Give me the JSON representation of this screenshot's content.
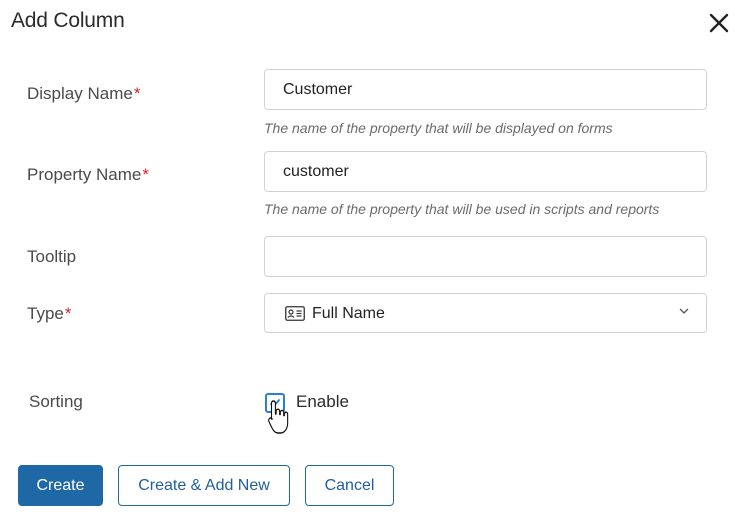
{
  "dialog": {
    "title": "Add Column"
  },
  "form": {
    "display_name": {
      "label": "Display Name",
      "required_mark": "*",
      "value": "Customer",
      "hint": "The name of the property that will be displayed on forms"
    },
    "property_name": {
      "label": "Property Name",
      "required_mark": "*",
      "value": "customer",
      "hint": "The name of the property that will be used in scripts and reports"
    },
    "tooltip": {
      "label": "Tooltip",
      "value": ""
    },
    "type": {
      "label": "Type",
      "required_mark": "*",
      "selected": "Full Name",
      "icon": "id-card-icon"
    },
    "sorting": {
      "label": "Sorting",
      "checkbox_label": "Enable",
      "checked": true
    }
  },
  "buttons": {
    "create": "Create",
    "create_add_new": "Create & Add New",
    "cancel": "Cancel"
  },
  "colors": {
    "primary": "#1f68a6",
    "required": "#d0262a",
    "checkbox_border": "#2f7fd0"
  }
}
